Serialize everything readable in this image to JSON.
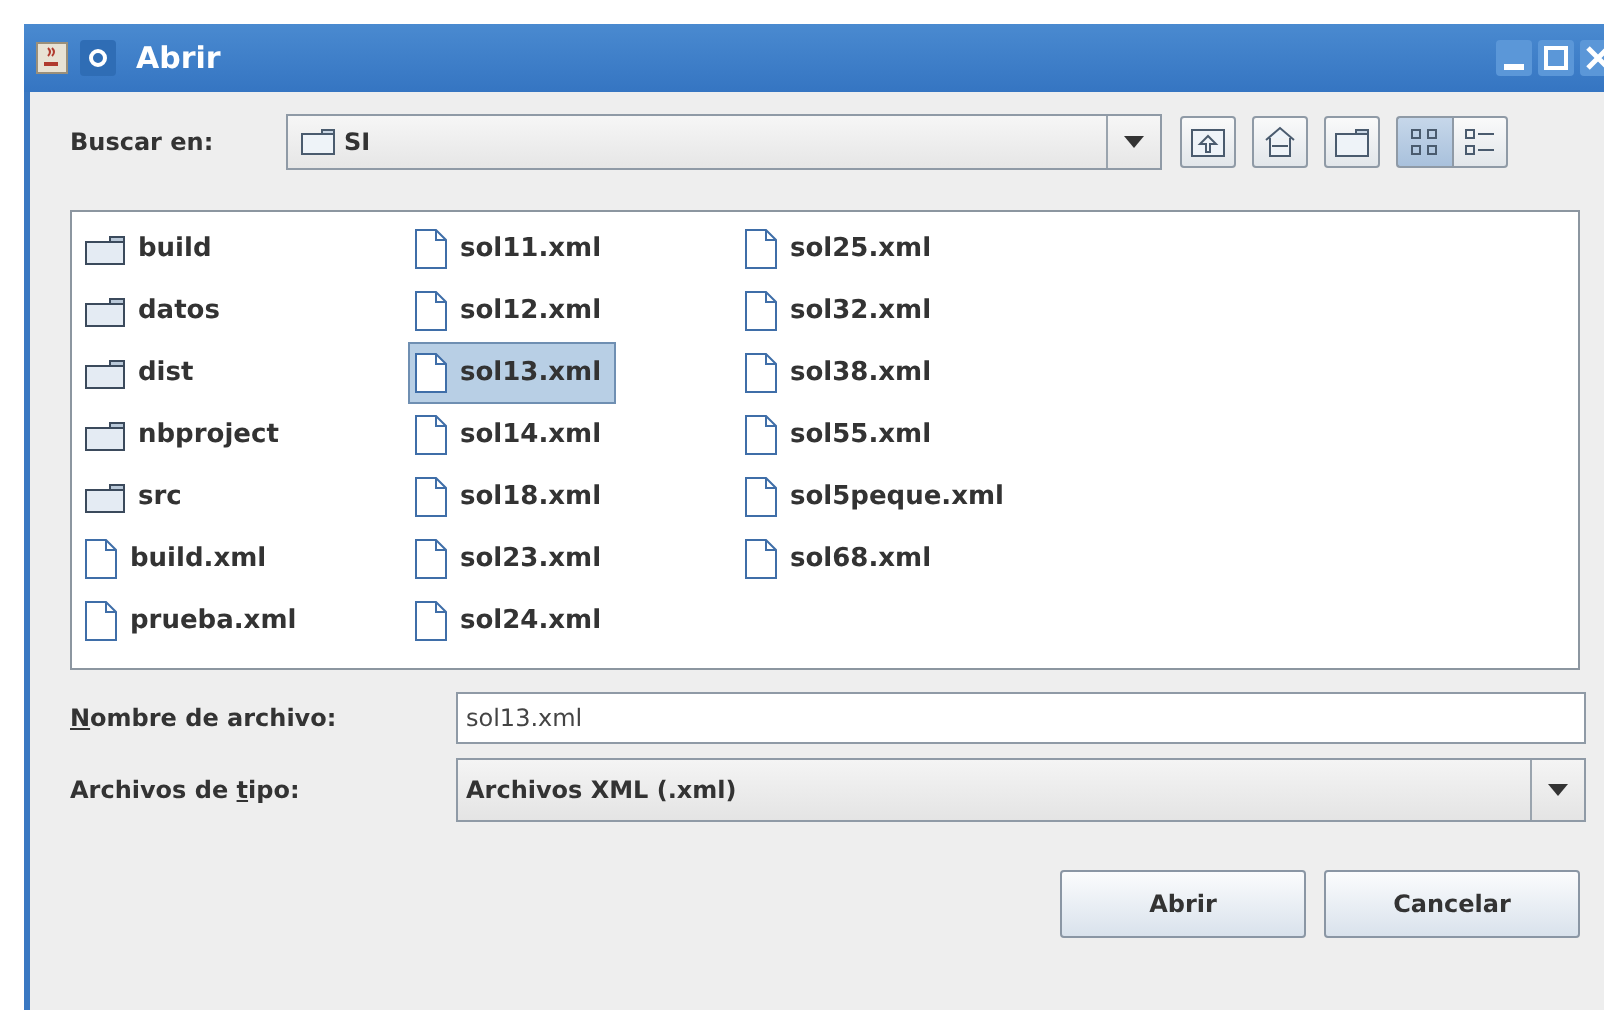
{
  "window": {
    "title": "Abrir"
  },
  "look_in": {
    "label": "Buscar en:",
    "value": "SI"
  },
  "files": [
    {
      "name": "build",
      "kind": "folder",
      "selected": false
    },
    {
      "name": "datos",
      "kind": "folder",
      "selected": false
    },
    {
      "name": "dist",
      "kind": "folder",
      "selected": false
    },
    {
      "name": "nbproject",
      "kind": "folder",
      "selected": false
    },
    {
      "name": "src",
      "kind": "folder",
      "selected": false
    },
    {
      "name": "build.xml",
      "kind": "file",
      "selected": false
    },
    {
      "name": "prueba.xml",
      "kind": "file",
      "selected": false
    },
    {
      "name": "sol11.xml",
      "kind": "file",
      "selected": false
    },
    {
      "name": "sol12.xml",
      "kind": "file",
      "selected": false
    },
    {
      "name": "sol13.xml",
      "kind": "file",
      "selected": true
    },
    {
      "name": "sol14.xml",
      "kind": "file",
      "selected": false
    },
    {
      "name": "sol18.xml",
      "kind": "file",
      "selected": false
    },
    {
      "name": "sol23.xml",
      "kind": "file",
      "selected": false
    },
    {
      "name": "sol24.xml",
      "kind": "file",
      "selected": false
    },
    {
      "name": "sol25.xml",
      "kind": "file",
      "selected": false
    },
    {
      "name": "sol32.xml",
      "kind": "file",
      "selected": false
    },
    {
      "name": "sol38.xml",
      "kind": "file",
      "selected": false
    },
    {
      "name": "sol55.xml",
      "kind": "file",
      "selected": false
    },
    {
      "name": "sol5peque.xml",
      "kind": "file",
      "selected": false
    },
    {
      "name": "sol68.xml",
      "kind": "file",
      "selected": false
    }
  ],
  "view_modes": [
    {
      "kind": "list",
      "selected": true
    },
    {
      "kind": "details",
      "selected": false
    }
  ],
  "file_name": {
    "mnemonic": "N",
    "label_rest": "ombre de archivo:",
    "value": "sol13.xml"
  },
  "file_type": {
    "label_start": "Archivos de ",
    "mnemonic": "t",
    "label_rest": "ipo:",
    "value": "Archivos XML (.xml)"
  },
  "buttons": [
    "Abrir",
    "Cancelar"
  ]
}
